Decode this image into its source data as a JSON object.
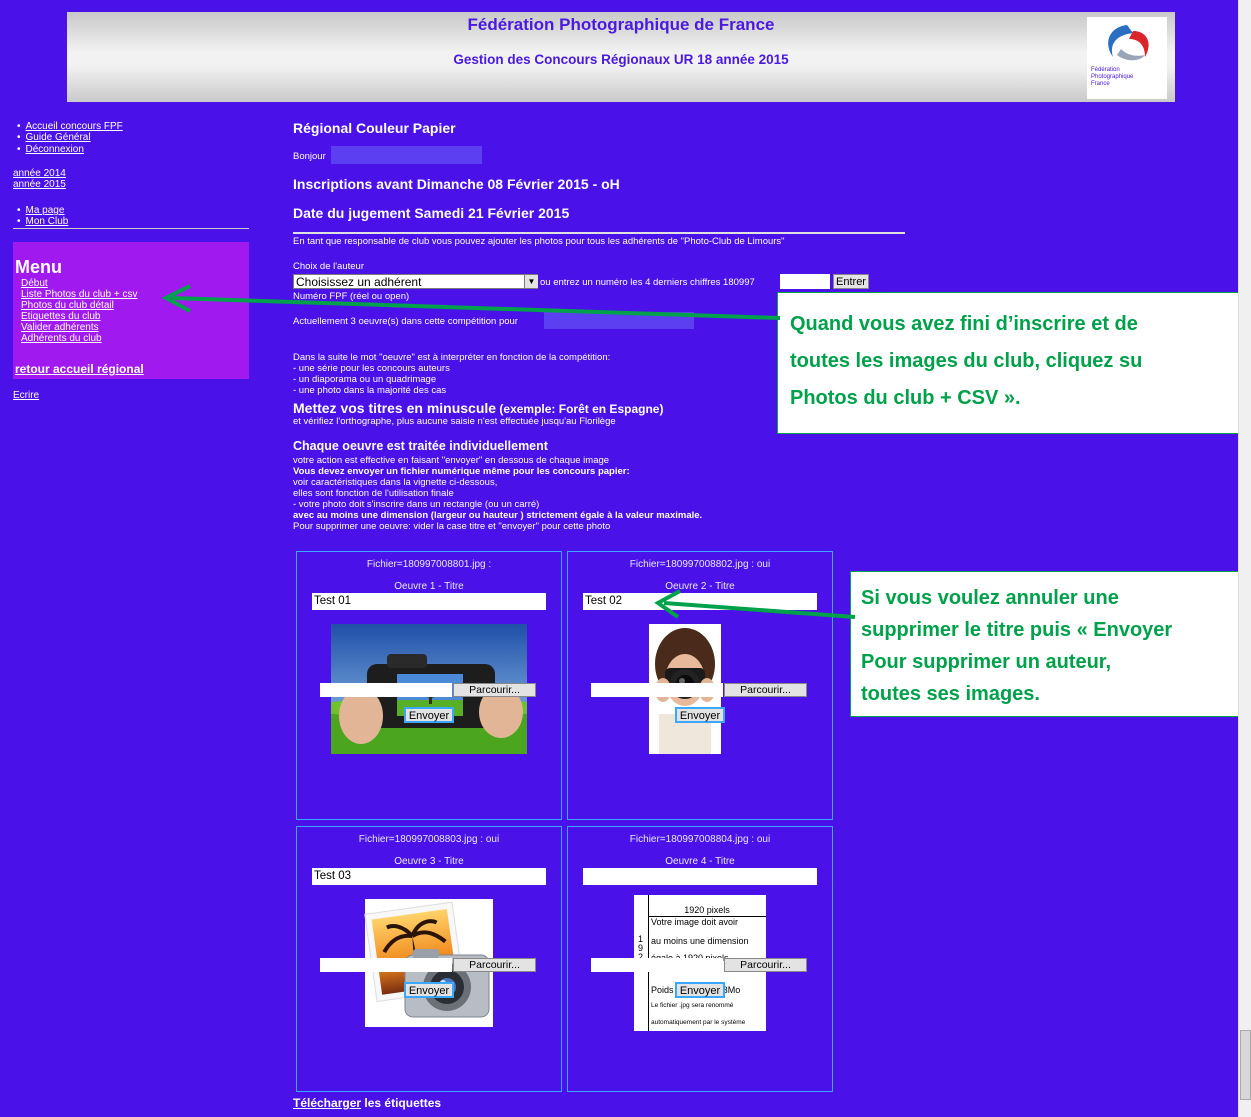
{
  "header": {
    "title": "Fédération Photographique de France",
    "subtitle": "Gestion des Concours Régionaux UR 18 année 2015",
    "logo_text": [
      "Fédération",
      "Photographique",
      "France"
    ]
  },
  "nav": {
    "top_links": [
      "Accueil concours FPF",
      "Guide Général",
      "Déconnexion"
    ],
    "year_links": [
      "année 2014",
      "année 2015"
    ],
    "page_links": [
      "Ma page",
      "Mon Club"
    ]
  },
  "menu": {
    "title": "Menu",
    "items": [
      "Début",
      "Liste Photos du club + csv",
      "Photos du club détail",
      "Etiquettes du club",
      "Valider adhérents",
      "Adhérents du club"
    ],
    "retour": "retour accueil régional"
  },
  "ecrire": "Ecrire",
  "main": {
    "title": "Régional Couleur Papier",
    "bonjour": "Bonjour",
    "inscriptions": "Inscriptions avant Dimanche 08 Février 2015 - oH",
    "jugement": "Date du jugement Samedi 21 Février 2015",
    "responsable": "En tant que responsable de club vous pouvez ajouter les photos pour tous les adhérents de \"Photo-Club de Limours\"",
    "choix_auteur": "Choix de l'auteur",
    "select_value": "Choisissez un adhérent",
    "ou_entrez": "ou entrez un numéro les 4 derniers chiffres 180997",
    "entrer_label": "Entrer",
    "numero_fpf": "Numéro FPF (réel ou open)",
    "actuellement": "Actuellement 3 oeuvre(s) dans cette compétition pour",
    "oeuvre_intro": "Dans la suite le mot \"oeuvre\" est à interpréter en fonction de la compétition:",
    "oeuvre_items": [
      "- une série pour les concours auteurs",
      "- un diaporama ou un quadrimage",
      "- une photo dans la majorité des cas"
    ],
    "minuscule_bold": "Mettez vos titres en minuscule",
    "minuscule_example": "(exemple: Forêt en Espagne)",
    "orthographe": "et vérifiez l'orthographe, plus aucune saisie n'est effectuée jusqu'au Florilège",
    "individuel_title": "Chaque oeuvre est traitée individuellement",
    "individuel_line1": "votre action est effective en faisant \"envoyer\" en dessous de chaque image",
    "individuel_line2": "Vous devez envoyer un fichier numérique même pour les concours papier:",
    "individuel_line3": "voir caractéristiques dans la vignette ci-dessous,",
    "individuel_line4": "elles sont fonction de l'utilisation finale",
    "individuel_line5": "- votre photo doit s'inscrire dans un rectangle (ou un carré)",
    "individuel_line6": "avec au moins une dimension (largeur ou hauteur ) strictement égale à la valeur maximale.",
    "individuel_line7": "Pour supprimer une oeuvre: vider la case titre et \"envoyer\" pour cette photo"
  },
  "works": [
    {
      "fichier": "Fichier=180997008801.jpg :",
      "oeuvre": "Oeuvre 1 - Titre",
      "titre": "Test 01",
      "thumb": "camera-field-photo"
    },
    {
      "fichier": "Fichier=180997008802.jpg : oui",
      "oeuvre": "Oeuvre 2 - Titre",
      "titre": "Test 02",
      "thumb": "woman-camera-photo"
    },
    {
      "fichier": "Fichier=180997008803.jpg : oui",
      "oeuvre": "Oeuvre 3 - Titre",
      "titre": "Test 03",
      "thumb": "camera-sunset-icon"
    },
    {
      "fichier": "Fichier=180997008804.jpg : oui",
      "oeuvre": "Oeuvre 4 - Titre",
      "titre": "",
      "thumb": "spec-placeholder"
    }
  ],
  "buttons": {
    "parcourir": "Parcourir...",
    "envoyer": "Envoyer"
  },
  "spec_card": {
    "header": "1920 pixels",
    "line1": "Votre image doit avoir",
    "line2": "au moins une dimension",
    "line3": "égale à 1920 pixels.",
    "vertical": [
      "1",
      "9",
      "2",
      "0"
    ],
    "weight": "Poids du fichier < 3Mo",
    "note1": "Le fichier .jpg sera renommé",
    "note2": "automatiquement par le système"
  },
  "footer": {
    "telecharger": "Télécharger",
    "etiquettes": "les étiquettes"
  },
  "callouts": {
    "top": [
      "Quand vous avez fini d’inscrire et de",
      "toutes les images du club, cliquez su",
      "Photos du club + CSV »."
    ],
    "mid": [
      "Si vous voulez annuler une",
      "supprimer le titre puis « Envoyer",
      "Pour supprimer un auteur,",
      "toutes ses images."
    ]
  },
  "colors": {
    "background": "#4a11e8",
    "menu": "#a01af0",
    "accent_green": "#00a14b",
    "cell_border": "#3ba7ff"
  }
}
